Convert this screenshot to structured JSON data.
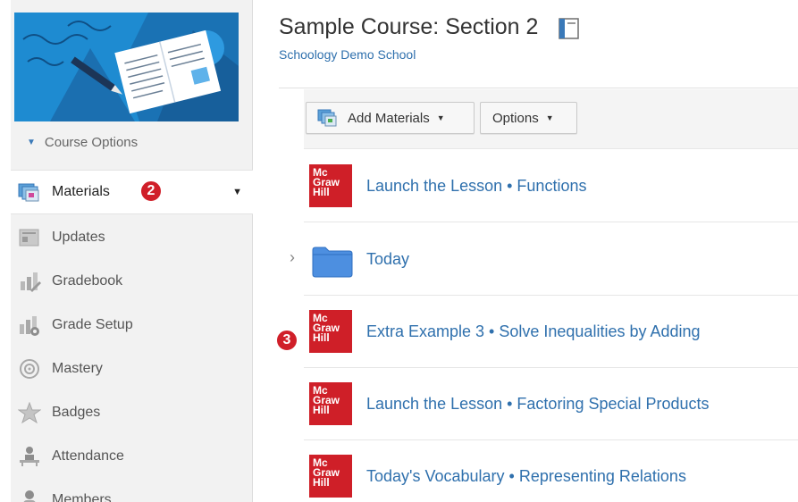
{
  "sidebar": {
    "course_options": "Course Options",
    "items": [
      {
        "label": "Materials",
        "icon": "materials-icon",
        "active": true
      },
      {
        "label": "Updates",
        "icon": "updates-icon"
      },
      {
        "label": "Gradebook",
        "icon": "gradebook-icon"
      },
      {
        "label": "Grade Setup",
        "icon": "grade-setup-icon"
      },
      {
        "label": "Mastery",
        "icon": "mastery-icon"
      },
      {
        "label": "Badges",
        "icon": "badges-icon"
      },
      {
        "label": "Attendance",
        "icon": "attendance-icon"
      },
      {
        "label": "Members",
        "icon": "members-icon"
      }
    ],
    "callout": "2"
  },
  "header": {
    "title": "Sample Course: Section 2",
    "school": "Schoology Demo School"
  },
  "toolbar": {
    "add_materials": "Add Materials",
    "options": "Options"
  },
  "materials": {
    "rows": [
      {
        "type": "mcgraw-hill",
        "title": "Launch the Lesson • Functions"
      },
      {
        "type": "folder",
        "title": "Today"
      },
      {
        "type": "mcgraw-hill",
        "title": "Extra Example 3 • Solve Inequalities by Adding"
      },
      {
        "type": "mcgraw-hill",
        "title": "Launch the Lesson • Factoring Special Products"
      },
      {
        "type": "mcgraw-hill",
        "title": "Today's Vocabulary • Representing Relations"
      }
    ],
    "callout": "3"
  },
  "logo_text": {
    "line1": "Mc",
    "line2": "Graw",
    "line3": "Hill"
  },
  "colors": {
    "accent_link": "#2f70ad",
    "mh_red": "#cf1f28",
    "badge_red": "#d01f29",
    "banner_blue": "#1e8bd1",
    "folder_blue": "#4d8fe0"
  }
}
